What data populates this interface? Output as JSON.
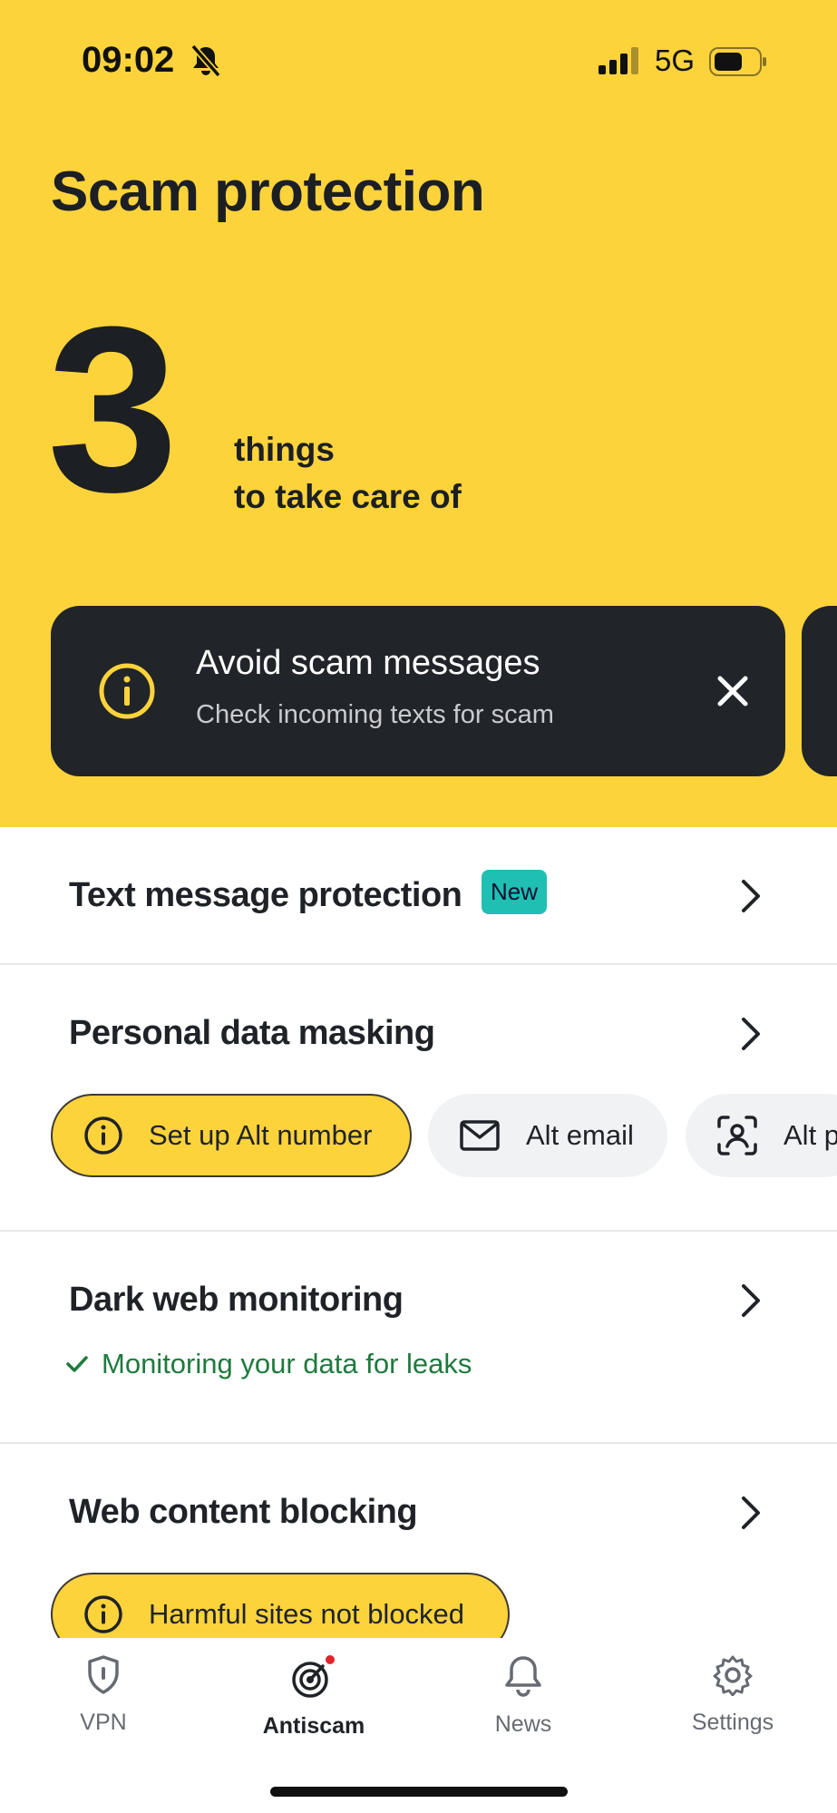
{
  "status_bar": {
    "time": "09:02",
    "network": "5G"
  },
  "header": {
    "title": "Scam protection",
    "count": "3",
    "caption_line1": "things",
    "caption_line2": "to take care of"
  },
  "alert_card": {
    "title": "Avoid scam messages",
    "subtitle": "Check incoming texts for scam"
  },
  "sections": {
    "text_message": {
      "title": "Text message protection",
      "badge": "New"
    },
    "masking": {
      "title": "Personal data masking",
      "pills": [
        "Set up Alt number",
        "Alt email",
        "Alt p"
      ]
    },
    "dark_web": {
      "title": "Dark web monitoring",
      "status": "Monitoring your data for leaks"
    },
    "web_blocking": {
      "title": "Web content blocking",
      "status": "Harmful sites not blocked"
    }
  },
  "tabs": [
    {
      "label": "VPN",
      "icon": "shield-icon"
    },
    {
      "label": "Antiscam",
      "icon": "radar-icon",
      "active": true
    },
    {
      "label": "News",
      "icon": "bell-icon"
    },
    {
      "label": "Settings",
      "icon": "gear-icon"
    }
  ],
  "colors": {
    "accent": "#fdd33c",
    "card": "#212429",
    "badge": "#1fbfb4",
    "success": "#1f7a3e"
  }
}
